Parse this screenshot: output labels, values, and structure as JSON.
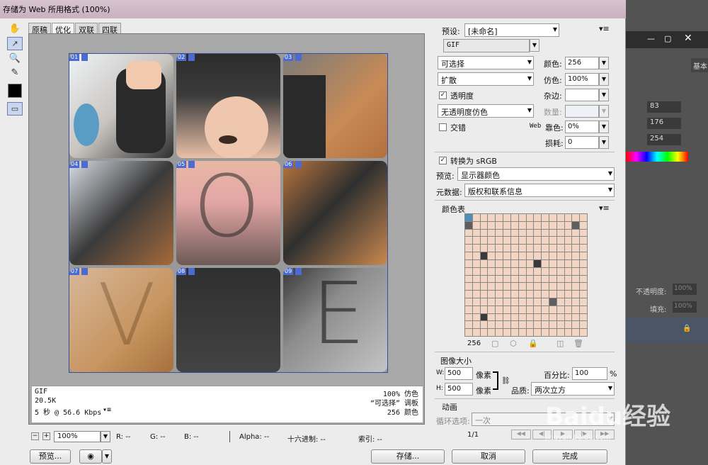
{
  "window": {
    "title": "存储为 Web 所用格式 (100%)"
  },
  "tabs": [
    "原稿",
    "优化",
    "双联",
    "四联"
  ],
  "slices": [
    "01",
    "02",
    "03",
    "04",
    "05",
    "06",
    "07",
    "08",
    "09"
  ],
  "letters": {
    "o": "O",
    "v": "V",
    "e": "E"
  },
  "info": {
    "format": "GIF",
    "size": "20.5K",
    "time": "5 秒 @ 56.6 Kbps",
    "dither": "100% 仿色",
    "palette": "“可选择” 调板",
    "colors": "256 颜色"
  },
  "status": {
    "zoom": "100%",
    "r": "R: --",
    "g": "G: --",
    "b": "B: --",
    "alpha": "Alpha: --",
    "hex": "十六进制: --",
    "index": "索引: --"
  },
  "buttons": {
    "preview": "预览...",
    "save": "存储...",
    "cancel": "取消",
    "done": "完成"
  },
  "settings": {
    "preset_label": "预设:",
    "preset": "[未命名]",
    "format": "GIF",
    "reduction": "可选择",
    "dither_algo": "扩散",
    "colors_label": "颜色:",
    "colors": "256",
    "dither_label": "仿色:",
    "dither": "100%",
    "transparency": "透明度",
    "matte_label": "杂边:",
    "trans_dither": "无透明度仿色",
    "amount_label": "数量:",
    "interlaced": "交错",
    "web_label": "Web",
    "websnap_label": "靠色:",
    "websnap": "0%",
    "lossy_label": "损耗:",
    "lossy": "0",
    "srgb": "转换为 sRGB",
    "preview_label": "预览:",
    "preview": "显示器颜色",
    "metadata_label": "元数据:",
    "metadata": "版权和联系信息",
    "colortable": "颜色表",
    "color_count": "256",
    "imagesize": "图像大小",
    "w_label": "W:",
    "w": "500",
    "h_label": "H:",
    "h": "500",
    "px": "像素",
    "px2": "像素",
    "percent_label": "百分比:",
    "percent": "100",
    "pct": "%",
    "quality_label": "品质:",
    "quality": "两次立方",
    "animation": "动画",
    "loop_label": "循环选项:",
    "loop": "一次",
    "frames": "1/1"
  },
  "ps_panel": {
    "label_basic": "基本",
    "v1": "83",
    "v2": "176",
    "v3": "254",
    "opacity_label": "不透明度:",
    "opacity": "100%",
    "fill_label": "填充:",
    "fill": "100%"
  },
  "watermark": {
    "text": "Baidu经验",
    "sub": "jingyan.baidu.com"
  },
  "colors": {
    "accent": "#4b6bd0",
    "slice_border": "#3a4f9a"
  }
}
